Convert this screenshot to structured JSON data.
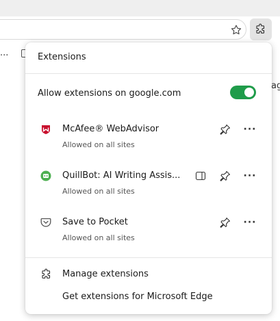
{
  "colors": {
    "toggle_on": "#1f9c4a",
    "mcafee_red": "#c8102e",
    "quillbot_green": "#4caf50",
    "pocket_gray": "#555555"
  },
  "browser": {
    "page_side_text": "ag",
    "bookmark_overflow": "..."
  },
  "panel": {
    "title": "Extensions",
    "allow_label": "Allow extensions on google.com",
    "allow_enabled": true,
    "extensions": [
      {
        "name": "McAfee® WebAdvisor",
        "status": "Allowed on all sites",
        "icon": "mcafee-icon",
        "has_sidepanel": false
      },
      {
        "name": "QuillBot: AI Writing Assis...",
        "status": "Allowed on all sites",
        "icon": "quillbot-icon",
        "has_sidepanel": true
      },
      {
        "name": "Save to Pocket",
        "status": "Allowed on all sites",
        "icon": "pocket-icon",
        "has_sidepanel": false
      }
    ],
    "footer": {
      "manage_label": "Manage extensions",
      "get_label": "Get extensions for Microsoft Edge"
    }
  }
}
